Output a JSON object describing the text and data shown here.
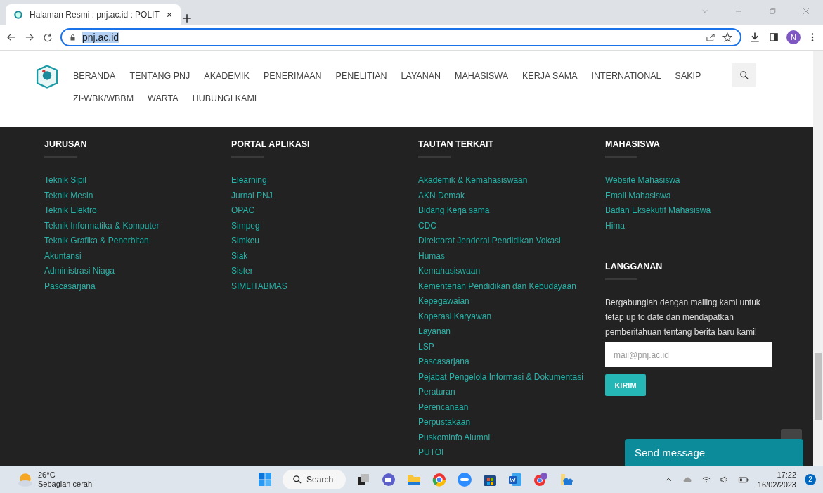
{
  "browser": {
    "tab_title": "Halaman Resmi : pnj.ac.id : POLIT",
    "url": "pnj.ac.id",
    "profile_initial": "N"
  },
  "nav": {
    "items": [
      "BERANDA",
      "TENTANG PNJ",
      "AKADEMIK",
      "PENERIMAAN",
      "PENELITIAN",
      "LAYANAN",
      "MAHASISWA",
      "KERJA SAMA",
      "INTERNATIONAL",
      "SAKIP",
      "ZI-WBK/WBBM",
      "WARTA",
      "HUBUNGI KAMI"
    ]
  },
  "footer": {
    "columns": [
      {
        "heading": "JURUSAN",
        "links": [
          "Teknik Sipil",
          "Teknik Mesin",
          "Teknik Elektro",
          "Teknik Informatika & Komputer",
          "Teknik Grafika & Penerbitan",
          "Akuntansi",
          "Administrasi Niaga",
          "Pascasarjana"
        ]
      },
      {
        "heading": "PORTAL APLIKASI",
        "links": [
          "Elearning",
          "Jurnal PNJ",
          "OPAC",
          "Simpeg",
          "Simkeu",
          "Siak",
          "Sister",
          "SIMLITABMAS"
        ]
      },
      {
        "heading": "TAUTAN TERKAIT",
        "links": [
          "Akademik & Kemahasiswaan",
          "AKN Demak",
          "Bidang Kerja sama",
          "CDC",
          "Direktorat Jenderal Pendidikan Vokasi",
          "Humas",
          "Kemahasiswaan",
          "Kementerian Pendidikan dan Kebudayaan",
          "Kepegawaian",
          "Koperasi Karyawan",
          "Layanan",
          "LSP",
          "Pascasarjana",
          "Pejabat Pengelola Informasi & Dokumentasi",
          "Peraturan",
          "Perencanaan",
          "Perpustakaan",
          "Puskominfo Alumni",
          "PUTOI"
        ]
      },
      {
        "heading": "MAHASISWA",
        "links": [
          "Website Mahasiswa",
          "Email Mahasiswa",
          "Badan Eksekutif Mahasiswa",
          "Hima"
        ]
      }
    ],
    "subscribe": {
      "heading": "LANGGANAN",
      "text": "Bergabunglah dengan mailing kami untuk tetap up to date dan mendapatkan pemberitahuan tentang berita baru kami!",
      "placeholder": "mail@pnj.ac.id",
      "button": "KIRIM"
    }
  },
  "chat": {
    "label": "Send message"
  },
  "taskbar": {
    "temperature": "26°C",
    "weather": "Sebagian cerah",
    "search": "Search",
    "time": "17:22",
    "date": "16/02/2023",
    "notifications": "2"
  }
}
